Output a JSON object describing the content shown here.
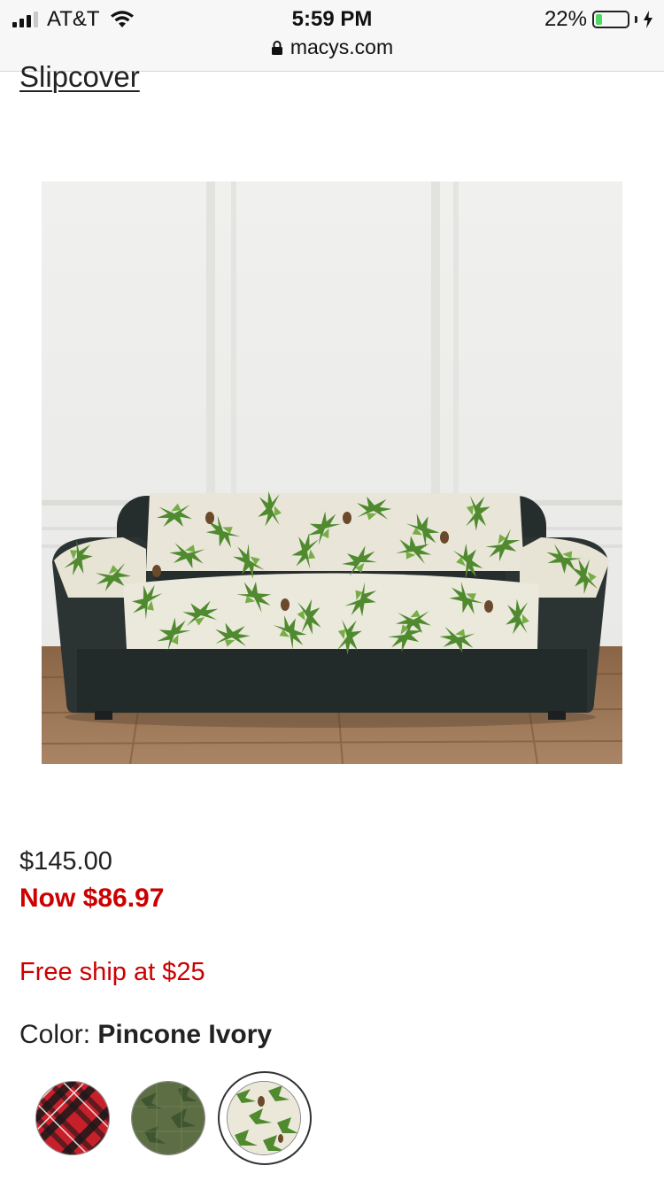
{
  "status_bar": {
    "carrier": "AT&T",
    "time": "5:59 PM",
    "url": "macys.com",
    "battery_percent": "22%",
    "battery_level": 0.22,
    "signal_bars": 4,
    "signal_bars_filled": 3
  },
  "product": {
    "title": "Slipcover",
    "image_alt": "pinecone patterned furniture cover on a dark sofa",
    "price_original": "$145.00",
    "price_now": "Now $86.97",
    "shipping": "Free ship at $25",
    "color_label": "Color:",
    "color_value": "Pincone Ivory",
    "swatches": [
      {
        "name": "red plaid"
      },
      {
        "name": "green pinecone"
      },
      {
        "name": "pincone ivory",
        "selected": true
      }
    ]
  },
  "colors": {
    "accent_red": "#cc0000",
    "battery_green": "#4cd964"
  }
}
